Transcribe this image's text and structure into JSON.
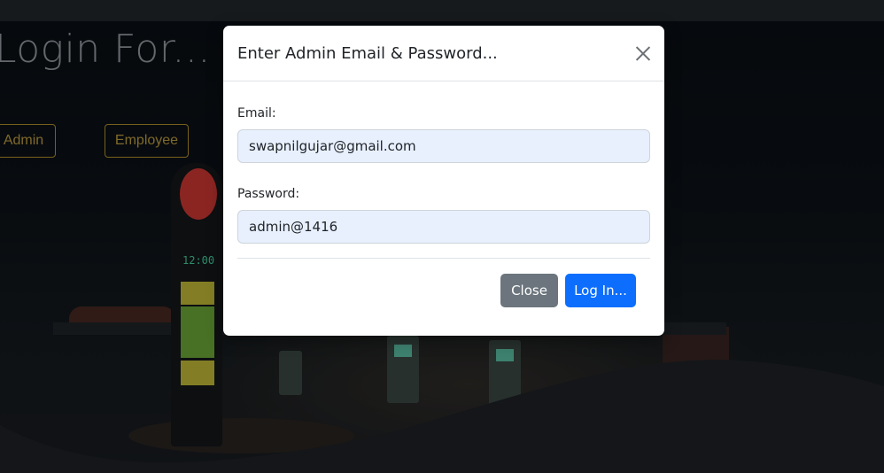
{
  "background": {
    "title": "Login For...",
    "role_buttons": [
      {
        "label": "Admin"
      },
      {
        "label": "Employee"
      }
    ],
    "pole_display": "12:00"
  },
  "modal": {
    "title": "Enter Admin Email & Password...",
    "close_icon": "close-icon",
    "email_label": "Email:",
    "email_value": "swapnilgujar@gmail.com",
    "password_label": "Password:",
    "password_value": "admin@1416",
    "close_label": "Close",
    "login_label": "Log In..."
  },
  "colors": {
    "primary": "#0d6efd",
    "secondary": "#6c757d",
    "accent_gold": "#c4a142",
    "autofill": "#e8f0fe"
  }
}
